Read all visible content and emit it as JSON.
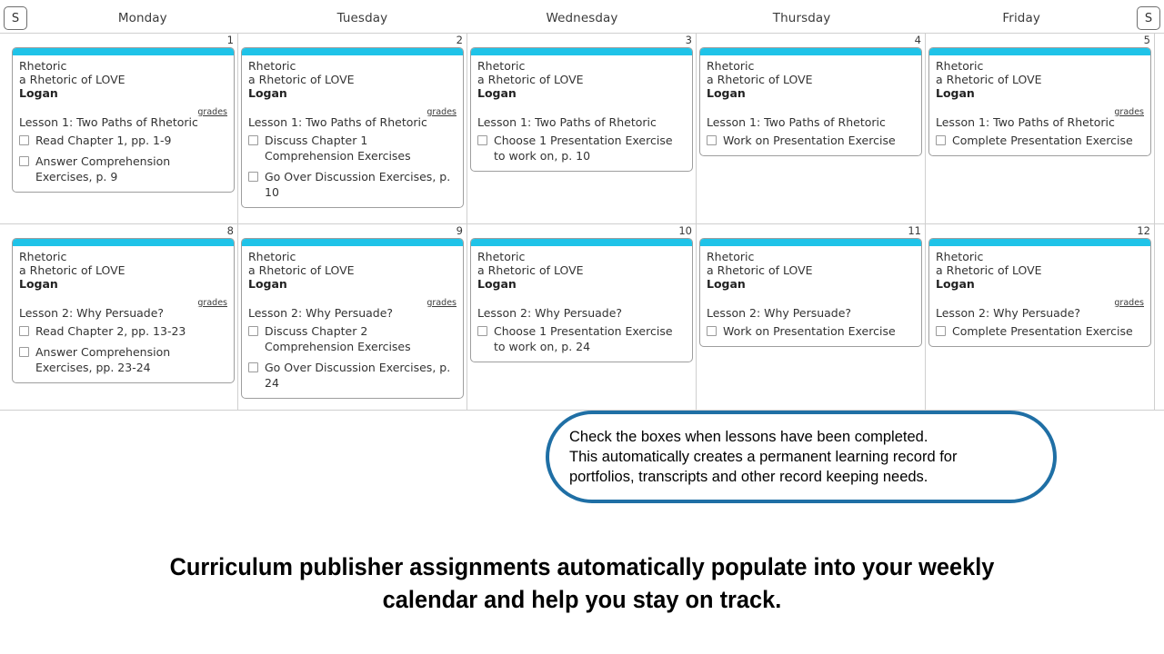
{
  "header": {
    "weekend_left_label": "S",
    "weekend_right_label": "S",
    "daynames": [
      "Monday",
      "Tuesday",
      "Wednesday",
      "Thursday",
      "Friday"
    ]
  },
  "labels": {
    "grades_link": "grades"
  },
  "weeks": [
    {
      "days": [
        {
          "date": "1",
          "course": "Rhetoric",
          "subtitle": "a Rhetoric of LOVE",
          "student": "Logan",
          "has_grades": true,
          "lesson": "Lesson 1: Two Paths of Rhetoric",
          "tasks": [
            "Read Chapter 1, pp. 1-9",
            "Answer Comprehension Exercises, p. 9"
          ]
        },
        {
          "date": "2",
          "course": "Rhetoric",
          "subtitle": "a Rhetoric of LOVE",
          "student": "Logan",
          "has_grades": true,
          "lesson": "Lesson 1: Two Paths of Rhetoric",
          "tasks": [
            "Discuss Chapter 1 Comprehension Exercises",
            "Go Over Discussion Exercises, p. 10"
          ]
        },
        {
          "date": "3",
          "course": "Rhetoric",
          "subtitle": "a Rhetoric of LOVE",
          "student": "Logan",
          "has_grades": false,
          "lesson": "Lesson 1: Two Paths of Rhetoric",
          "tasks": [
            "Choose 1 Presentation Exercise to work on, p. 10"
          ]
        },
        {
          "date": "4",
          "course": "Rhetoric",
          "subtitle": "a Rhetoric of LOVE",
          "student": "Logan",
          "has_grades": false,
          "lesson": "Lesson 1: Two Paths of Rhetoric",
          "tasks": [
            "Work on Presentation Exercise"
          ]
        },
        {
          "date": "5",
          "course": "Rhetoric",
          "subtitle": "a Rhetoric of LOVE",
          "student": "Logan",
          "has_grades": true,
          "lesson": "Lesson 1: Two Paths of Rhetoric",
          "tasks": [
            "Complete Presentation Exercise"
          ]
        }
      ]
    },
    {
      "days": [
        {
          "date": "8",
          "course": "Rhetoric",
          "subtitle": "a Rhetoric of LOVE",
          "student": "Logan",
          "has_grades": true,
          "lesson": "Lesson 2: Why Persuade?",
          "tasks": [
            "Read Chapter 2, pp. 13-23",
            "Answer Comprehension Exercises, pp. 23-24"
          ]
        },
        {
          "date": "9",
          "course": "Rhetoric",
          "subtitle": "a Rhetoric of LOVE",
          "student": "Logan",
          "has_grades": true,
          "lesson": "Lesson 2: Why Persuade?",
          "tasks": [
            "Discuss Chapter 2 Comprehension Exercises",
            "Go Over Discussion Exercises, p. 24"
          ]
        },
        {
          "date": "10",
          "course": "Rhetoric",
          "subtitle": "a Rhetoric of LOVE",
          "student": "Logan",
          "has_grades": false,
          "lesson": "Lesson 2: Why Persuade?",
          "tasks": [
            "Choose 1 Presentation Exercise to work on, p. 24"
          ]
        },
        {
          "date": "11",
          "course": "Rhetoric",
          "subtitle": "a Rhetoric of LOVE",
          "student": "Logan",
          "has_grades": false,
          "lesson": "Lesson 2: Why Persuade?",
          "tasks": [
            "Work on Presentation Exercise"
          ]
        },
        {
          "date": "12",
          "course": "Rhetoric",
          "subtitle": "a Rhetoric of LOVE",
          "student": "Logan",
          "has_grades": true,
          "lesson": "Lesson 2: Why Persuade?",
          "tasks": [
            "Complete Presentation Exercise"
          ]
        }
      ]
    }
  ],
  "callout": {
    "text": "Check the boxes when lessons have been completed.\nThis automatically creates a permanent learning record for\nportfolios, transcripts and other record keeping needs."
  },
  "caption": {
    "text": "Curriculum publisher assignments automatically populate into your weekly\ncalendar and help you stay on track."
  },
  "colors": {
    "card_accent": "#1fc3e8",
    "callout_border": "#1f6fa5",
    "grid_line": "#cfcfcf",
    "card_border": "#9e9e9e"
  }
}
